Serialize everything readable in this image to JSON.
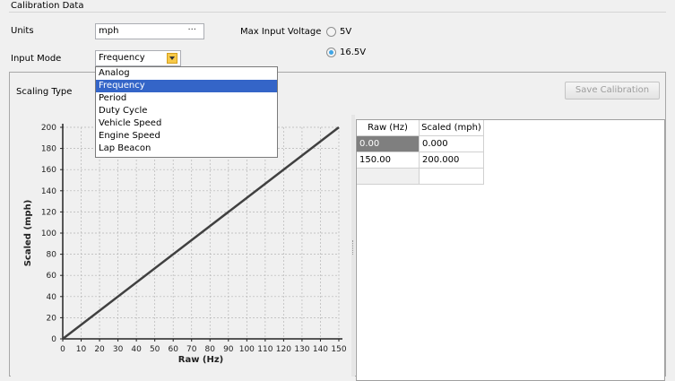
{
  "calibration": {
    "section_title": "Calibration Data",
    "units_label": "Units",
    "units_value": "mph",
    "units_button": "···",
    "max_voltage_label": "Max Input Voltage",
    "voltage_options": [
      "5V",
      "16.5V"
    ],
    "voltage_selected": "16.5V",
    "input_mode_label": "Input Mode",
    "input_mode_value": "Frequency",
    "input_mode_options": [
      "Analog",
      "Frequency",
      "Period",
      "Duty Cycle",
      "Vehicle Speed",
      "Engine Speed",
      "Lap Beacon"
    ],
    "scaling_type_label": "Scaling Type",
    "save_button": "Save Calibration"
  },
  "colors": {
    "selection": "#3465c8",
    "radio_selected": "#3fa5e6",
    "grid": "#b5b5b5",
    "line": "#404040"
  },
  "table": {
    "headers": [
      "Raw (Hz)",
      "Scaled (mph)"
    ],
    "rows": [
      [
        "0.00",
        "0.000"
      ],
      [
        "150.00",
        "200.000"
      ],
      [
        "",
        ""
      ]
    ]
  },
  "chart_data": {
    "type": "line",
    "xlabel": "Raw (Hz)",
    "ylabel": "Scaled (mph)",
    "xlim": [
      0,
      150
    ],
    "ylim": [
      0,
      200
    ],
    "x_ticks": [
      0,
      10,
      20,
      30,
      40,
      50,
      60,
      70,
      80,
      90,
      100,
      110,
      120,
      130,
      140,
      150
    ],
    "y_ticks": [
      0,
      20,
      40,
      60,
      80,
      100,
      120,
      140,
      160,
      180,
      200
    ],
    "grid": true,
    "series": [
      {
        "x": [
          0,
          150
        ],
        "y": [
          0,
          200
        ]
      }
    ]
  }
}
